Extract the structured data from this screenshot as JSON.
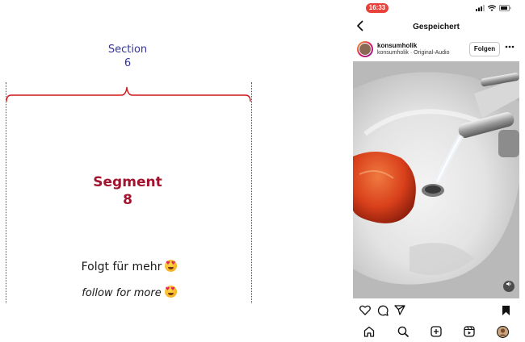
{
  "annotation": {
    "section_word": "Section",
    "section_number": "6",
    "segment_word": "Segment",
    "segment_number": "8",
    "caption_de": "Folgt für mehr",
    "caption_en": "follow for more",
    "section_color": "#34349a",
    "segment_color": "#a3122e",
    "emoji_icon": "heart-eyes-emoji"
  },
  "status_bar": {
    "time": "16:33",
    "icons": [
      "signal-icon",
      "wifi-icon",
      "battery-icon"
    ]
  },
  "header": {
    "back_icon": "chevron-left-icon",
    "title": "Gespeichert"
  },
  "post": {
    "username": "konsumholik",
    "subtitle": "konsumholik · Original-Audio",
    "follow_label": "Folgen",
    "more_icon": "more-dots-icon",
    "audio_icon": "speaker-icon"
  },
  "post_actions": [
    "heart-icon",
    "comment-icon",
    "share-icon",
    "bookmark-icon"
  ],
  "bottom_nav": [
    "home-icon",
    "search-icon",
    "add-post-icon",
    "reels-icon",
    "profile-avatar"
  ]
}
